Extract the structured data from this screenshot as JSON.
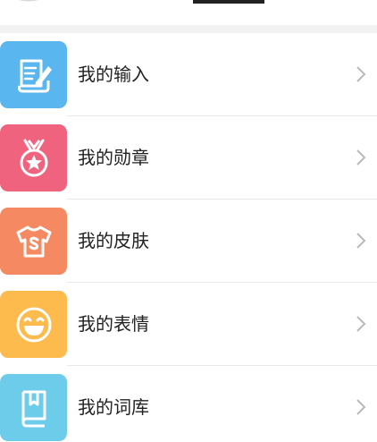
{
  "colors": {
    "input_tile": "#5AB6EE",
    "medal_tile": "#F0637F",
    "skin_tile": "#F58A62",
    "emoji_tile": "#FDBA4D",
    "dict_tile": "#6CCCEA",
    "chevron": "#B9B9B9"
  },
  "menu": {
    "items": [
      {
        "label": "我的输入",
        "icon": "quill-document-icon"
      },
      {
        "label": "我的勋章",
        "icon": "medal-star-icon"
      },
      {
        "label": "我的皮肤",
        "icon": "tshirt-icon"
      },
      {
        "label": "我的表情",
        "icon": "smiley-face-icon"
      },
      {
        "label": "我的词库",
        "icon": "book-icon"
      }
    ]
  }
}
